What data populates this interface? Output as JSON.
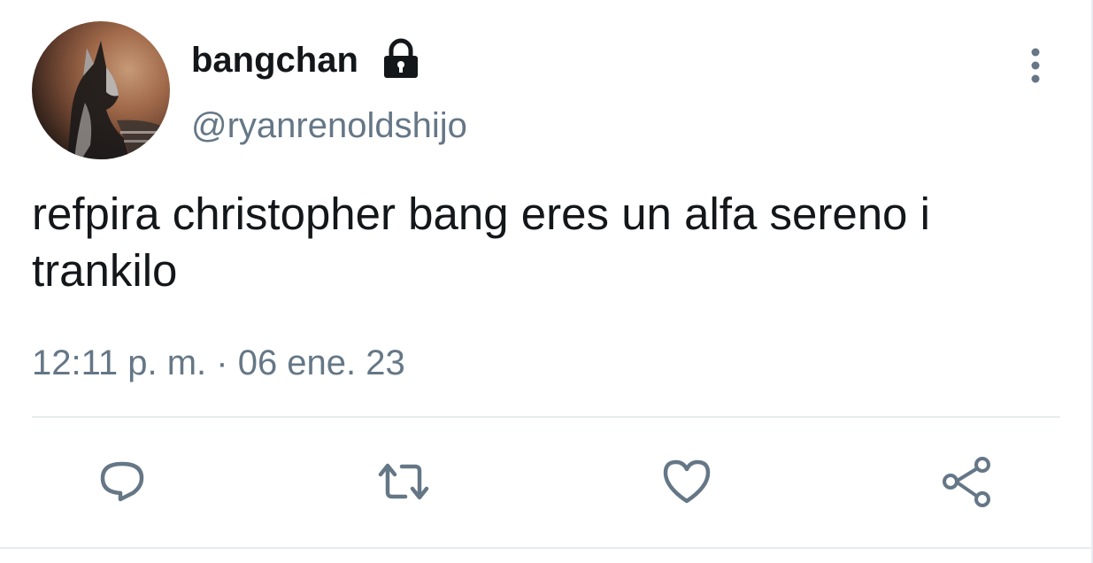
{
  "author": {
    "display_name": "bangchan",
    "handle": "@ryanrenoldshijo",
    "protected": true,
    "avatar_icon": "wolf-avatar"
  },
  "tweet": {
    "text": "refpira christopher bang eres un alfa sereno i trankilo",
    "timestamp": "12:11 p. m. · 06 ene. 23"
  },
  "actions": [
    {
      "icon": "reply-icon"
    },
    {
      "icon": "retweet-icon"
    },
    {
      "icon": "like-icon"
    },
    {
      "icon": "share-icon"
    }
  ],
  "colors": {
    "text_primary": "#14171a",
    "text_secondary": "#657786",
    "icon": "#657786",
    "divider": "#e6ecf0"
  }
}
